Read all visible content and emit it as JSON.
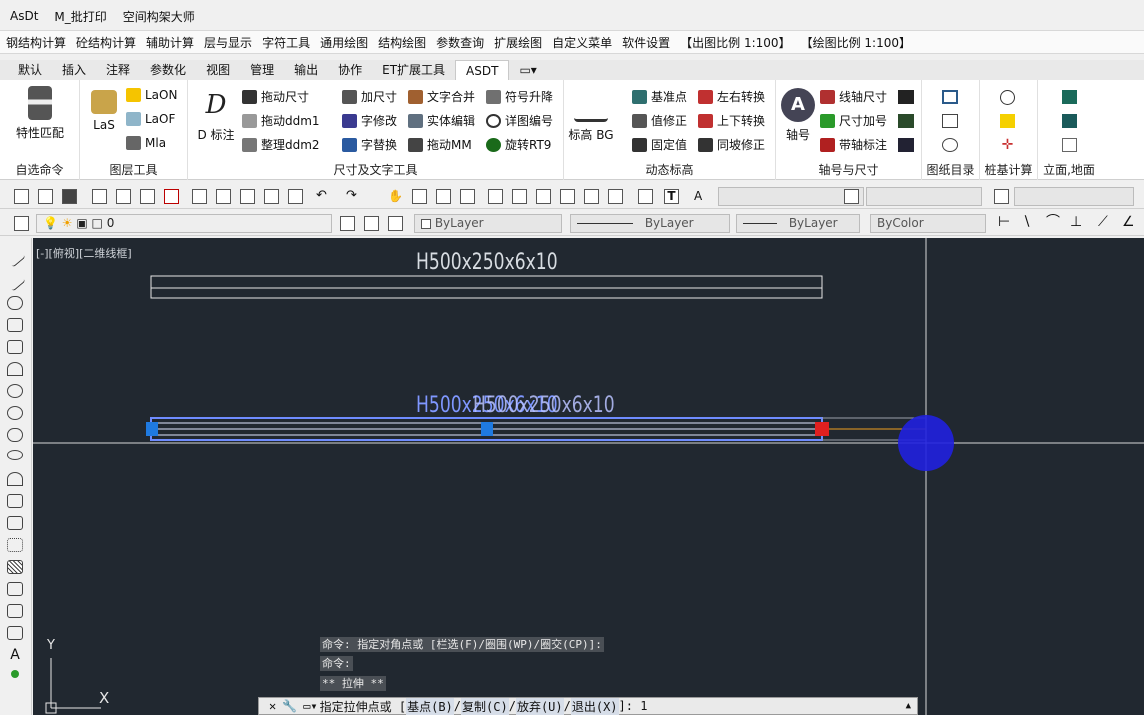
{
  "menu": {
    "items": [
      "AsDt",
      "M_批打印",
      "空间构架大师"
    ]
  },
  "custom_menu": {
    "items": [
      "钢结构计算",
      "砼结构计算",
      "辅助计算",
      "层与显示",
      "字符工具",
      "通用绘图",
      "结构绘图",
      "参数查询",
      "扩展绘图",
      "自定义菜单",
      "软件设置",
      "【出图比例 1:100】",
      "【绘图比例 1:100】"
    ]
  },
  "tabs": [
    "默认",
    "插入",
    "注释",
    "参数化",
    "视图",
    "管理",
    "输出",
    "协作",
    "ET扩展工具",
    "ASDT"
  ],
  "ribbon": {
    "p1": {
      "title": "自选命令",
      "big": "特性匹配"
    },
    "p2": {
      "title": "图层工具",
      "las": "LaS",
      "laon": "LaON",
      "laof": "LaOF",
      "mla": "Mla"
    },
    "p3": {
      "title": "尺寸及文字工具",
      "dmark": "D 标注",
      "b1": "拖动尺寸",
      "b2": "拖动ddm1",
      "b3": "整理ddm2",
      "b4": "加尺寸",
      "b5": "字修改",
      "b6": "字替换",
      "b7": "文字合并",
      "b8": "实体编辑",
      "b9": "拖动MM",
      "b10": "符号升降",
      "b11": "详图编号",
      "b12": "旋转RT9"
    },
    "p4": {
      "title": "动态标高",
      "big": "标高 BG",
      "b1": "基准点",
      "b2": "值修正",
      "b3": "固定值",
      "b4": "左右转换",
      "b5": "上下转换",
      "b6": "同坡修正"
    },
    "p5": {
      "title": "轴号与尺寸",
      "big": "轴号",
      "b1": "线轴尺寸",
      "b2": "尺寸加号",
      "b3": "带轴标注"
    },
    "p6": {
      "title": "图纸目录"
    },
    "p7": {
      "title": "桩基计算"
    },
    "p8": {
      "title": "立面,地面"
    }
  },
  "props": {
    "layer": "0",
    "color": "ByLayer",
    "linetype": "ByLayer",
    "lineweight": "ByLayer",
    "plotstyle": "ByColor"
  },
  "viewport_label": "[-][俯视][二维线框]",
  "drawing": {
    "top_label": "H500x250x6x10",
    "mid_label_a": "H500x250x6x10",
    "mid_label_b": "H500x250x6x10"
  },
  "command_history": [
    "命令: 指定对角点或 [栏选(F)/圈围(WP)/圈交(CP)]:",
    "命令:",
    "** 拉伸 **"
  ],
  "command_prompt": {
    "prefix": "指定拉伸点或 [",
    "opt1": "基点(B)",
    "opt2": "复制(C)",
    "opt3": "放弃(U)",
    "opt4": "退出(X)",
    "suffix": "]: 1"
  },
  "ucs": {
    "x": "X",
    "y": "Y"
  },
  "colors": {
    "canvas": "#212830",
    "selection": "#6f8cff",
    "grip_blue": "#1f7ae0",
    "grip_red": "#e02020",
    "cursor_circle": "#2020e0"
  }
}
